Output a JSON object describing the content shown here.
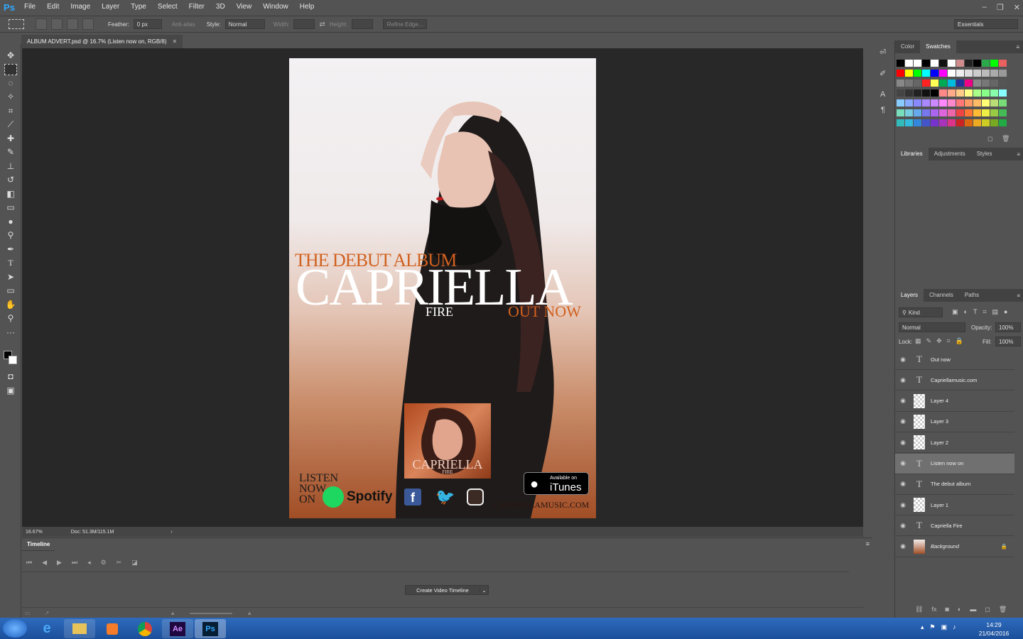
{
  "app": {
    "logo": "Ps"
  },
  "menu": [
    "File",
    "Edit",
    "Image",
    "Layer",
    "Type",
    "Select",
    "Filter",
    "3D",
    "View",
    "Window",
    "Help"
  ],
  "options": {
    "feather_label": "Feather:",
    "feather_value": "0 px",
    "anti_alias": "Anti-alias",
    "style_label": "Style:",
    "style_value": "Normal",
    "width_label": "Width:",
    "height_label": "Height:",
    "refine_edge": "Refine Edge...",
    "workspace": "Essentials"
  },
  "document": {
    "tab_title": "ALBUM ADVERT.psd @ 16.7% (Listen  now  on, RGB/8)",
    "zoom": "16.67%",
    "doc_info": "Doc: 51.3M/115.1M"
  },
  "poster": {
    "debut": "THE DEBUT ALBUM",
    "artist": "CAPRIELLA",
    "fire": "FIRE",
    "out_now": "OUT NOW",
    "album_artist": "CAPRIELLA",
    "album_title": "FIRE",
    "listen": [
      "LISTEN",
      "NOW",
      "ON"
    ],
    "spotify": "Spotify",
    "itunes_small": "Available on",
    "itunes": "iTunes",
    "website": "CAPRIELLAMUSIC.COM"
  },
  "timeline": {
    "title": "Timeline",
    "create_button": "Create Video Timeline"
  },
  "color_panel": {
    "tabs": [
      "Color",
      "Swatches"
    ]
  },
  "library_panel": {
    "tabs": [
      "Libraries",
      "Adjustments",
      "Styles"
    ]
  },
  "layers_panel": {
    "tabs": [
      "Layers",
      "Channels",
      "Paths"
    ],
    "kind": "Kind",
    "blend": "Normal",
    "opacity_label": "Opacity:",
    "opacity": "100%",
    "lock_label": "Lock:",
    "fill_label": "Fill:",
    "fill": "100%",
    "layers": [
      {
        "name": "Out now",
        "type": "text"
      },
      {
        "name": "Capriellamusic.com",
        "type": "text"
      },
      {
        "name": "Layer 4",
        "type": "pixel"
      },
      {
        "name": "Layer 3",
        "type": "pixel"
      },
      {
        "name": "Layer 2",
        "type": "pixel"
      },
      {
        "name": "Listen  now  on",
        "type": "text",
        "selected": true
      },
      {
        "name": "The debut album",
        "type": "text"
      },
      {
        "name": "Layer 1",
        "type": "pixel"
      },
      {
        "name": "Capriella Fire",
        "type": "text"
      },
      {
        "name": "Background",
        "type": "image",
        "locked": true
      }
    ]
  },
  "taskbar": {
    "time": "14:29",
    "date": "21/04/2016"
  },
  "colors": {
    "accent_orange": "#d1611f",
    "ps_blue": "#31a8ff",
    "panel_bg": "#535353",
    "canvas_bg": "#282828"
  }
}
